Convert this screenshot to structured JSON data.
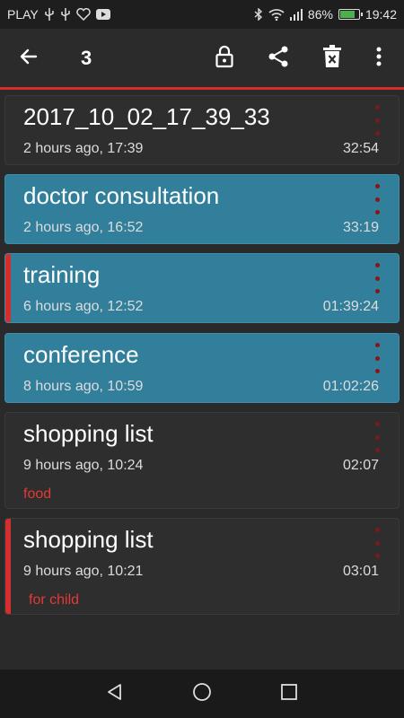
{
  "status_bar": {
    "carrier": "PLAY",
    "battery_percent": "86%",
    "battery_level": 0.86,
    "time": "19:42"
  },
  "toolbar": {
    "selected_count": "3"
  },
  "colors": {
    "accent": "#d32f2f",
    "selected_card": "#327f9c",
    "tag_text": "#e53935"
  },
  "recordings": [
    {
      "title": "2017_10_02_17_39_33",
      "meta": "2 hours ago, 17:39",
      "duration": "32:54",
      "tag": "",
      "selected": false,
      "marked": false
    },
    {
      "title": "doctor consultation",
      "meta": "2 hours ago, 16:52",
      "duration": "33:19",
      "tag": "",
      "selected": true,
      "marked": false
    },
    {
      "title": "training",
      "meta": "6 hours ago, 12:52",
      "duration": "01:39:24",
      "tag": "",
      "selected": true,
      "marked": true
    },
    {
      "title": "conference",
      "meta": "8 hours ago, 10:59",
      "duration": "01:02:26",
      "tag": "",
      "selected": true,
      "marked": false
    },
    {
      "title": "shopping list",
      "meta": "9 hours ago, 10:24",
      "duration": "02:07",
      "tag": "food",
      "selected": false,
      "marked": false
    },
    {
      "title": "shopping list",
      "meta": "9 hours ago, 10:21",
      "duration": "03:01",
      "tag": "for child",
      "selected": false,
      "marked": true
    }
  ]
}
